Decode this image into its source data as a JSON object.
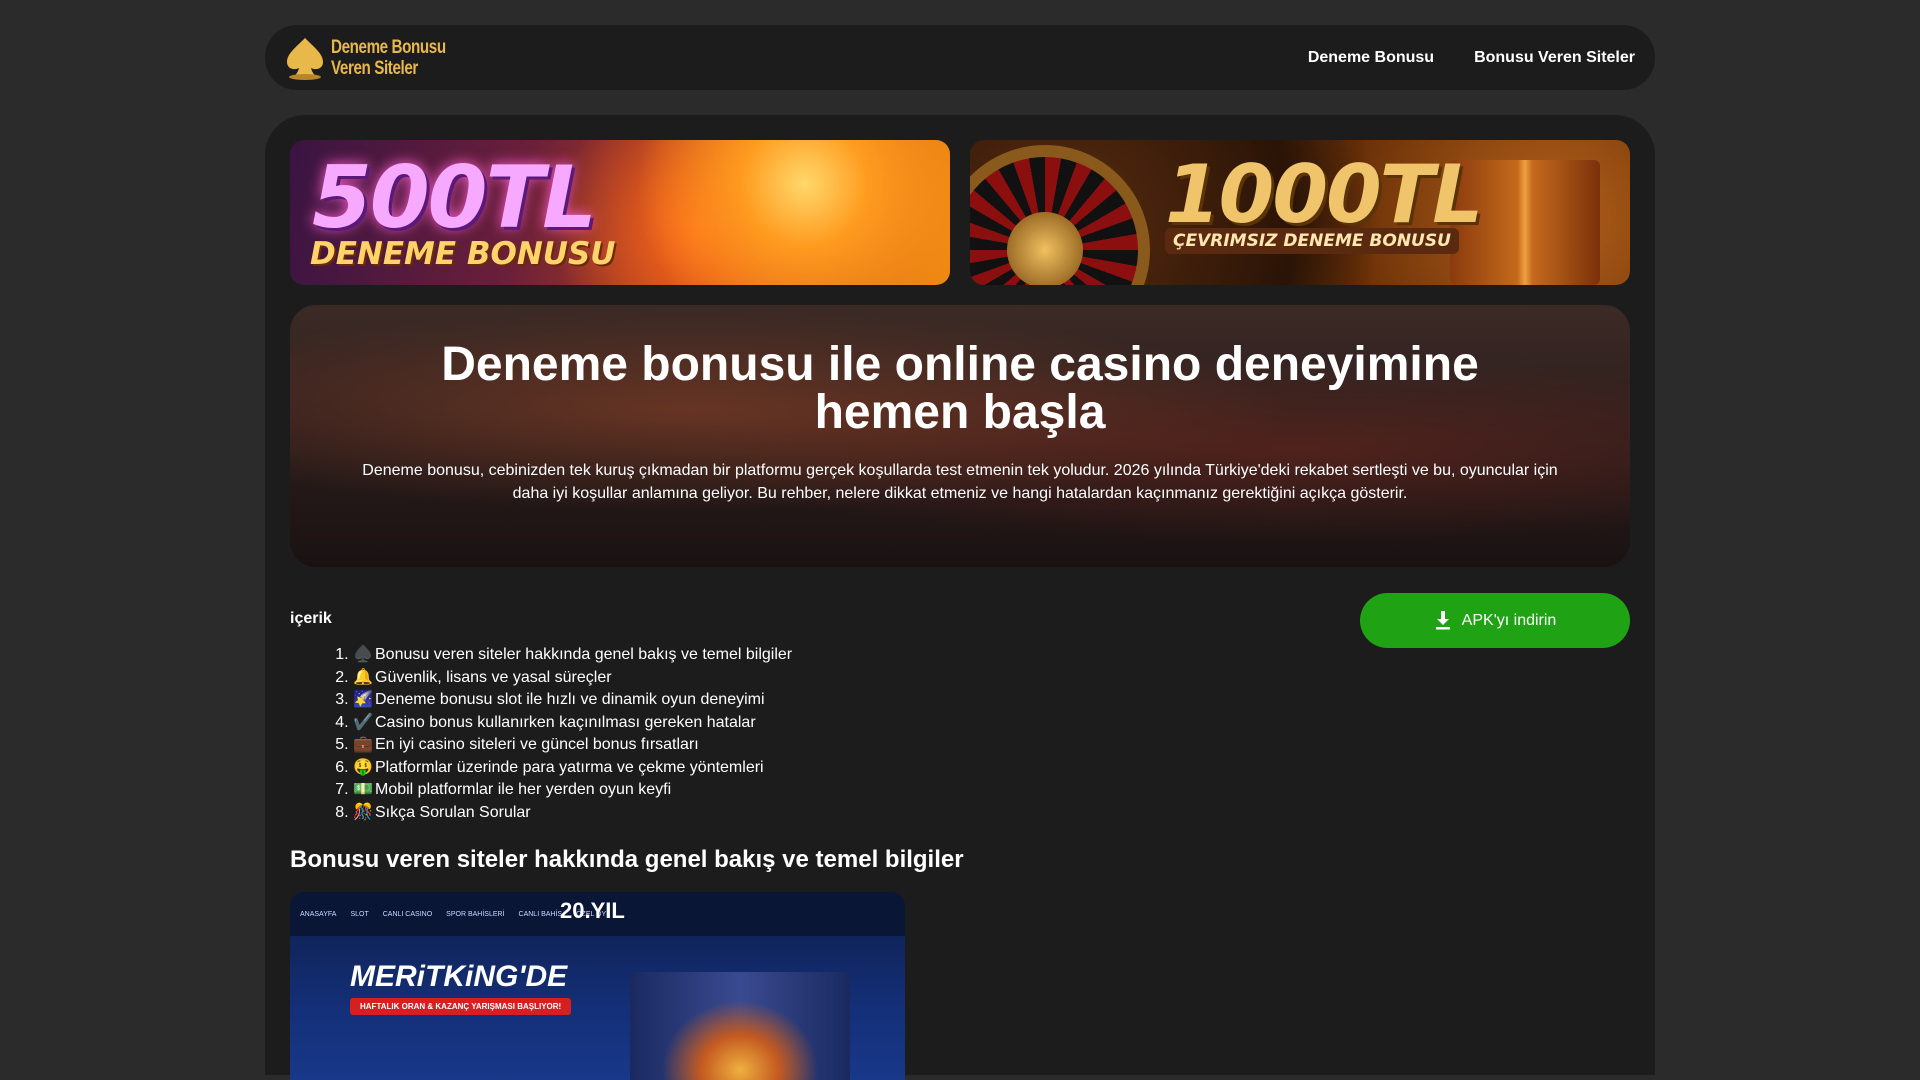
{
  "header": {
    "logo_line1": "Deneme Bonusu",
    "logo_line2": "Veren Siteler",
    "nav": [
      "Deneme Bonusu",
      "Bonusu Veren Siteler"
    ]
  },
  "banners": [
    {
      "big": "500TL",
      "sub": "DENEME BONUSU"
    },
    {
      "big": "1000TL",
      "sub": "ÇEVRIMSIZ DENEME BONUSU"
    }
  ],
  "hero": {
    "title": "Deneme bonusu ile online casino deneyimine hemen başla",
    "text": "Deneme bonusu, cebinizden tek kuruş çıkmadan bir platformu gerçek koşullarda test etmenin tek yoludur. 2026 yılında Türkiye'deki rekabet sertleşti ve bu, oyuncular için daha iyi koşullar anlamına geliyor. Bu rehber, nelere dikkat etmeniz ve hangi hatalardan kaçınmanız gerektiğini açıkça gösterir."
  },
  "toc": {
    "title": "içerik",
    "apk_button": "APK'yı indirin",
    "items": [
      {
        "icon": "♠️",
        "label": "Bonusu veren siteler hakkında genel bakış ve temel bilgiler"
      },
      {
        "icon": "🔔",
        "label": "Güvenlik, lisans ve yasal süreçler"
      },
      {
        "icon": "🌠",
        "label": "Deneme bonusu slot ile hızlı ve dinamik oyun deneyimi"
      },
      {
        "icon": "✔️",
        "label": "Casino bonus kullanırken kaçınılması gereken hatalar"
      },
      {
        "icon": "💼",
        "label": "En iyi casino siteleri ve güncel bonus fırsatları"
      },
      {
        "icon": "🤑",
        "label": "Platformlar üzerinde para yatırma ve çekme yöntemleri"
      },
      {
        "icon": "💵",
        "label": "Mobil platformlar ile her yerden oyun keyfi"
      },
      {
        "icon": "🎊",
        "label": "Sıkça Sorulan Sorular"
      }
    ]
  },
  "section": {
    "heading": "Bonusu veren siteler hakkında genel bakış ve temel bilgiler"
  },
  "screenshot": {
    "year": "20.YIL",
    "title": "MERiTKiNG'DE",
    "badge": "HAFTALIK ORAN & KAZANÇ YARIŞMASI BAŞLIYOR!",
    "menu": [
      "ANASAYFA",
      "SLOT",
      "CANLI CASINO",
      "SPOR BAHİSLERİ",
      "CANLI BAHİS",
      "ÖZEL OY"
    ]
  },
  "colors": {
    "page_bg": "#2b2b2b",
    "panel_bg": "#1c1c1c",
    "accent_green": "#1fa214",
    "logo_gold": "#e8b84a"
  }
}
